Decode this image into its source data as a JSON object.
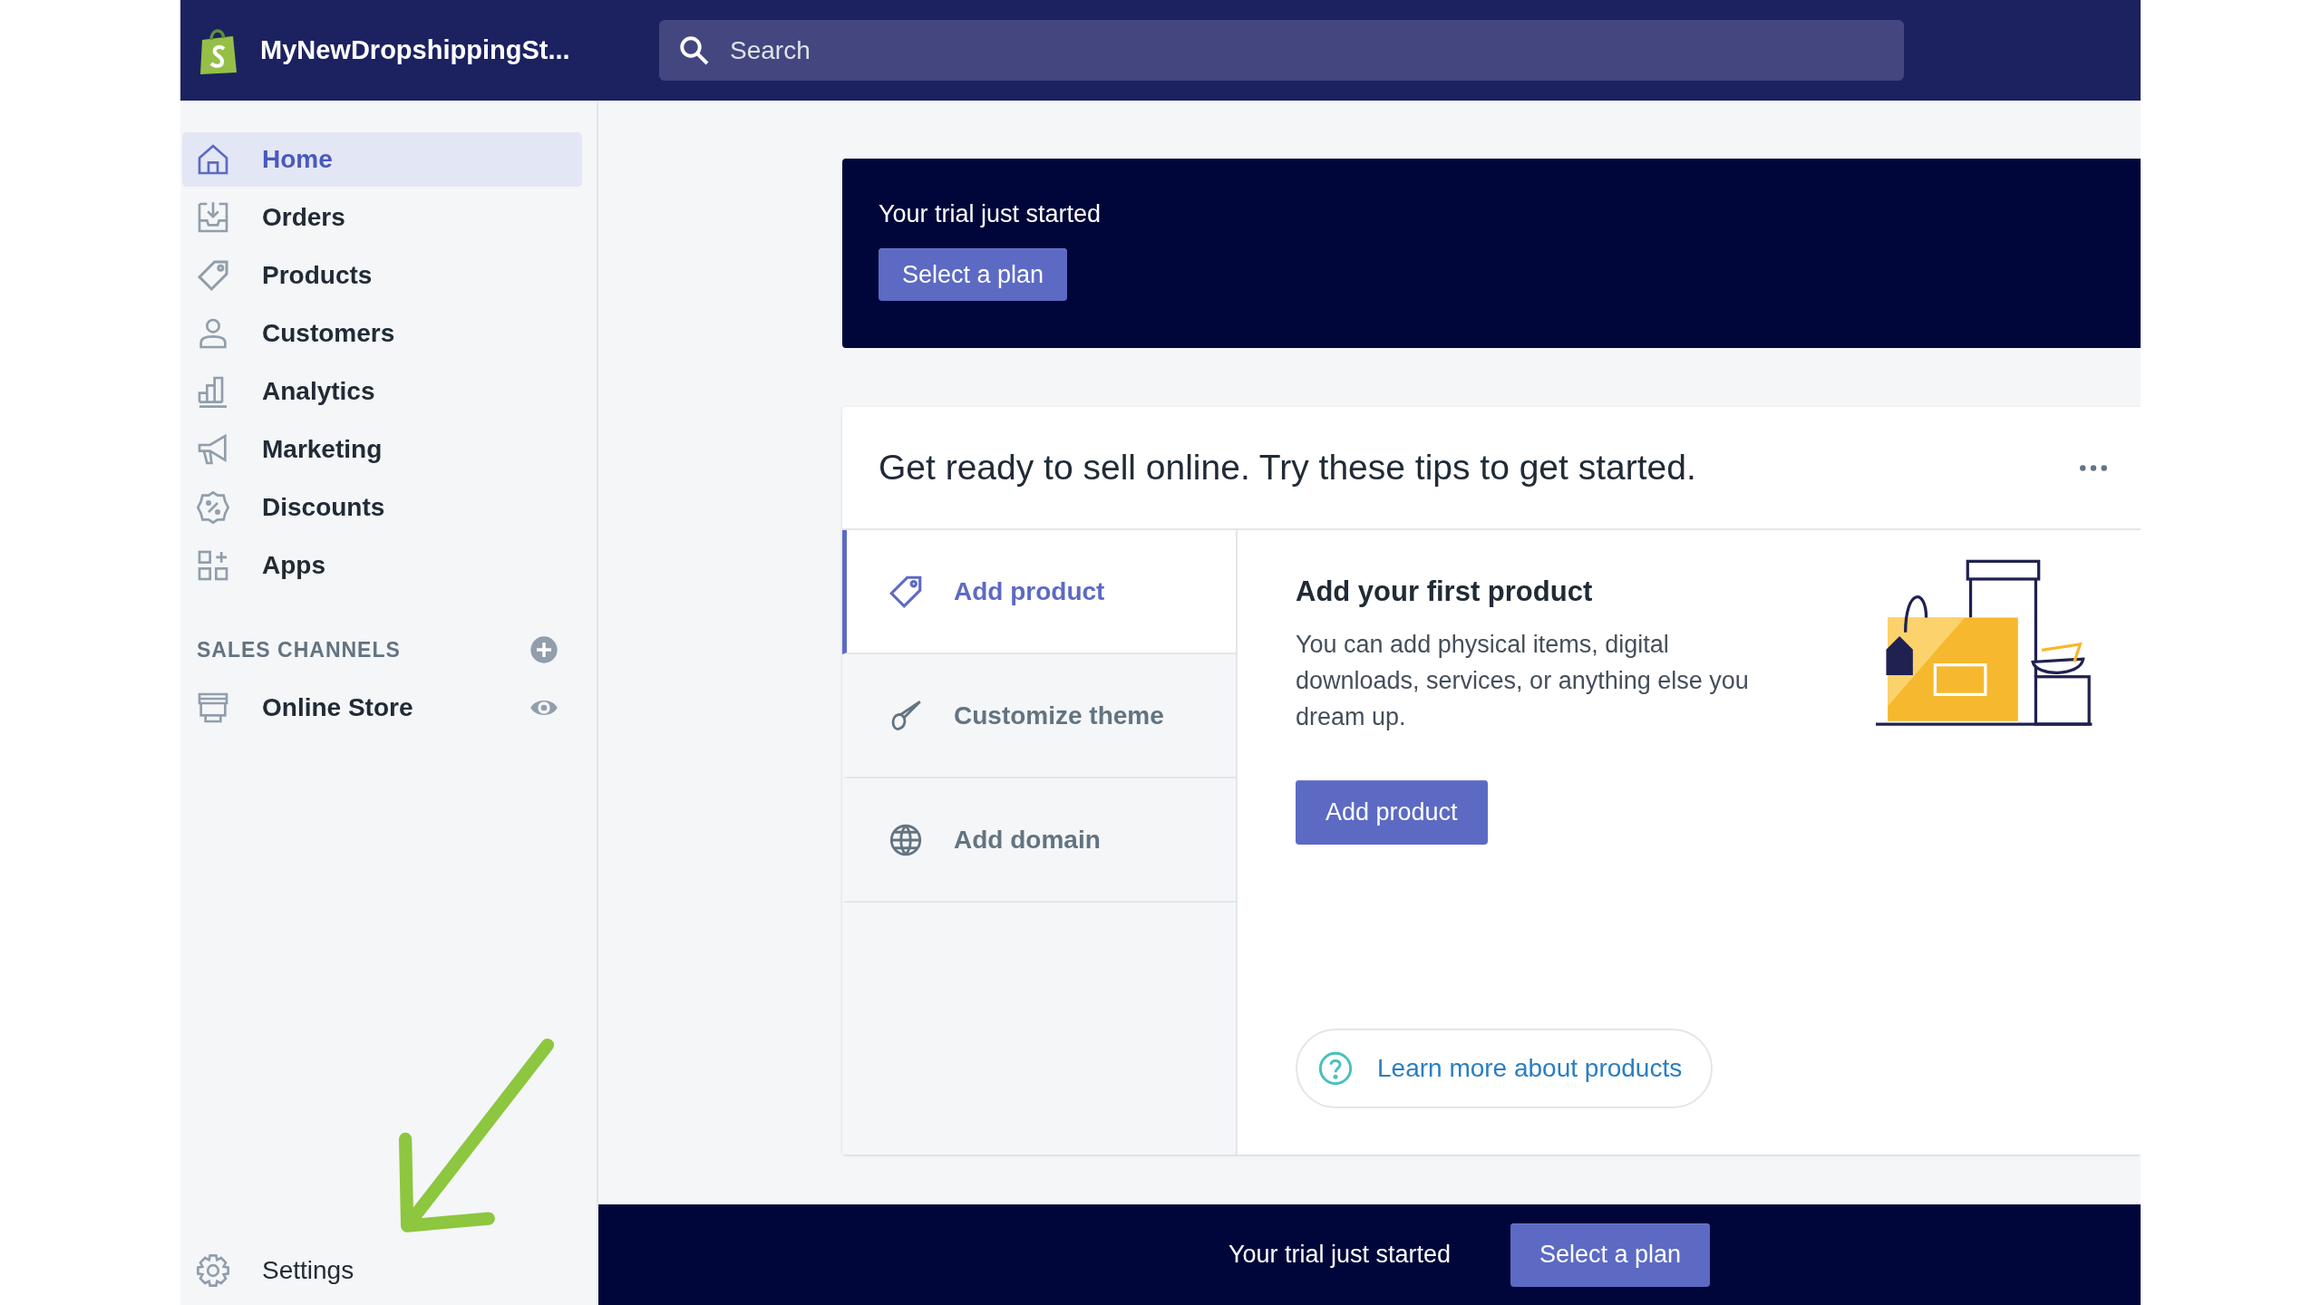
{
  "store": {
    "name": "MyNewDropshippingSt..."
  },
  "search": {
    "placeholder": "Search"
  },
  "nav": [
    {
      "label": "Home",
      "kind": "home",
      "selected": true
    },
    {
      "label": "Orders",
      "kind": "inbox",
      "selected": false
    },
    {
      "label": "Products",
      "kind": "tag",
      "selected": false
    },
    {
      "label": "Customers",
      "kind": "person",
      "selected": false
    },
    {
      "label": "Analytics",
      "kind": "chart",
      "selected": false
    },
    {
      "label": "Marketing",
      "kind": "megaphone",
      "selected": false
    },
    {
      "label": "Discounts",
      "kind": "discount",
      "selected": false
    },
    {
      "label": "Apps",
      "kind": "apps",
      "selected": false
    }
  ],
  "sales_channels": {
    "heading": "SALES CHANNELS",
    "items": [
      {
        "label": "Online Store"
      }
    ]
  },
  "settings": {
    "label": "Settings"
  },
  "trial_banner": {
    "text": "Your trial just started",
    "button": "Select a plan"
  },
  "tips": {
    "title": "Get ready to sell online. Try these tips to get started.",
    "tabs": [
      {
        "label": "Add product",
        "kind": "tag",
        "selected": true
      },
      {
        "label": "Customize theme",
        "kind": "brush",
        "selected": false
      },
      {
        "label": "Add domain",
        "kind": "globe",
        "selected": false
      }
    ],
    "detail": {
      "title": "Add your first product",
      "text": "You can add physical items, digital downloads, services, or anything else you dream up.",
      "button": "Add product",
      "help_link": "Learn more about products"
    }
  },
  "bottom_bar": {
    "text": "Your trial just started",
    "button": "Select a plan"
  }
}
